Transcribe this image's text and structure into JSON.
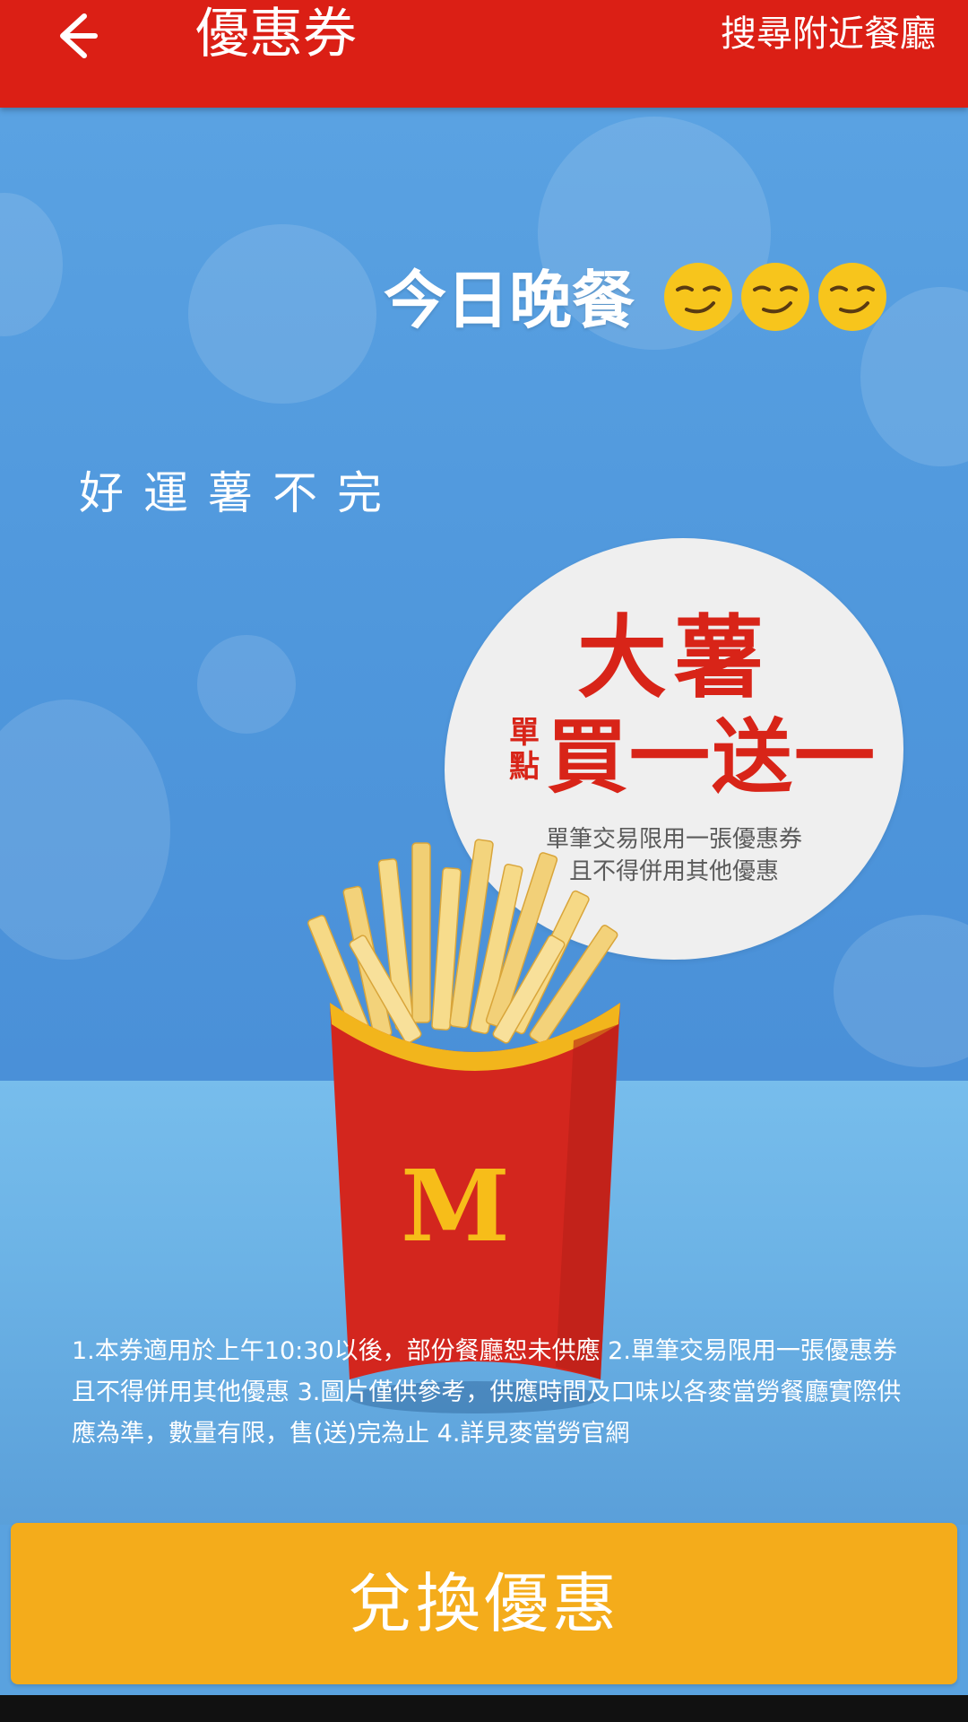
{
  "header": {
    "title": "優惠券",
    "back_icon": "arrow-left-icon",
    "search_label": "搜尋附近餐廳",
    "background": "#db1f15"
  },
  "coupon": {
    "headline": "今日晚餐",
    "emojis": [
      "smirk-face-icon",
      "smirk-face-icon",
      "smirk-face-icon"
    ],
    "tagline": "好運薯不完",
    "bubble": {
      "product": "大薯",
      "qualifier_top": "單",
      "qualifier_bottom": "點",
      "offer": "買一送一",
      "note_line1": "單筆交易限用一張優惠券",
      "note_line2": "且不得併用其他優惠"
    },
    "terms": "1.本券適用於上午10:30以後，部份餐廳恕未供應 2.單筆交易限用一張優惠券且不得併用其他優惠 3.圖片僅供參考，供應時間及口味以各麥當勞餐廳實際供應為準，數量有限，售(送)完為止 4.詳見麥當勞官網"
  },
  "redeem": {
    "label": "兌換優惠",
    "color": "#f4ac1b"
  }
}
